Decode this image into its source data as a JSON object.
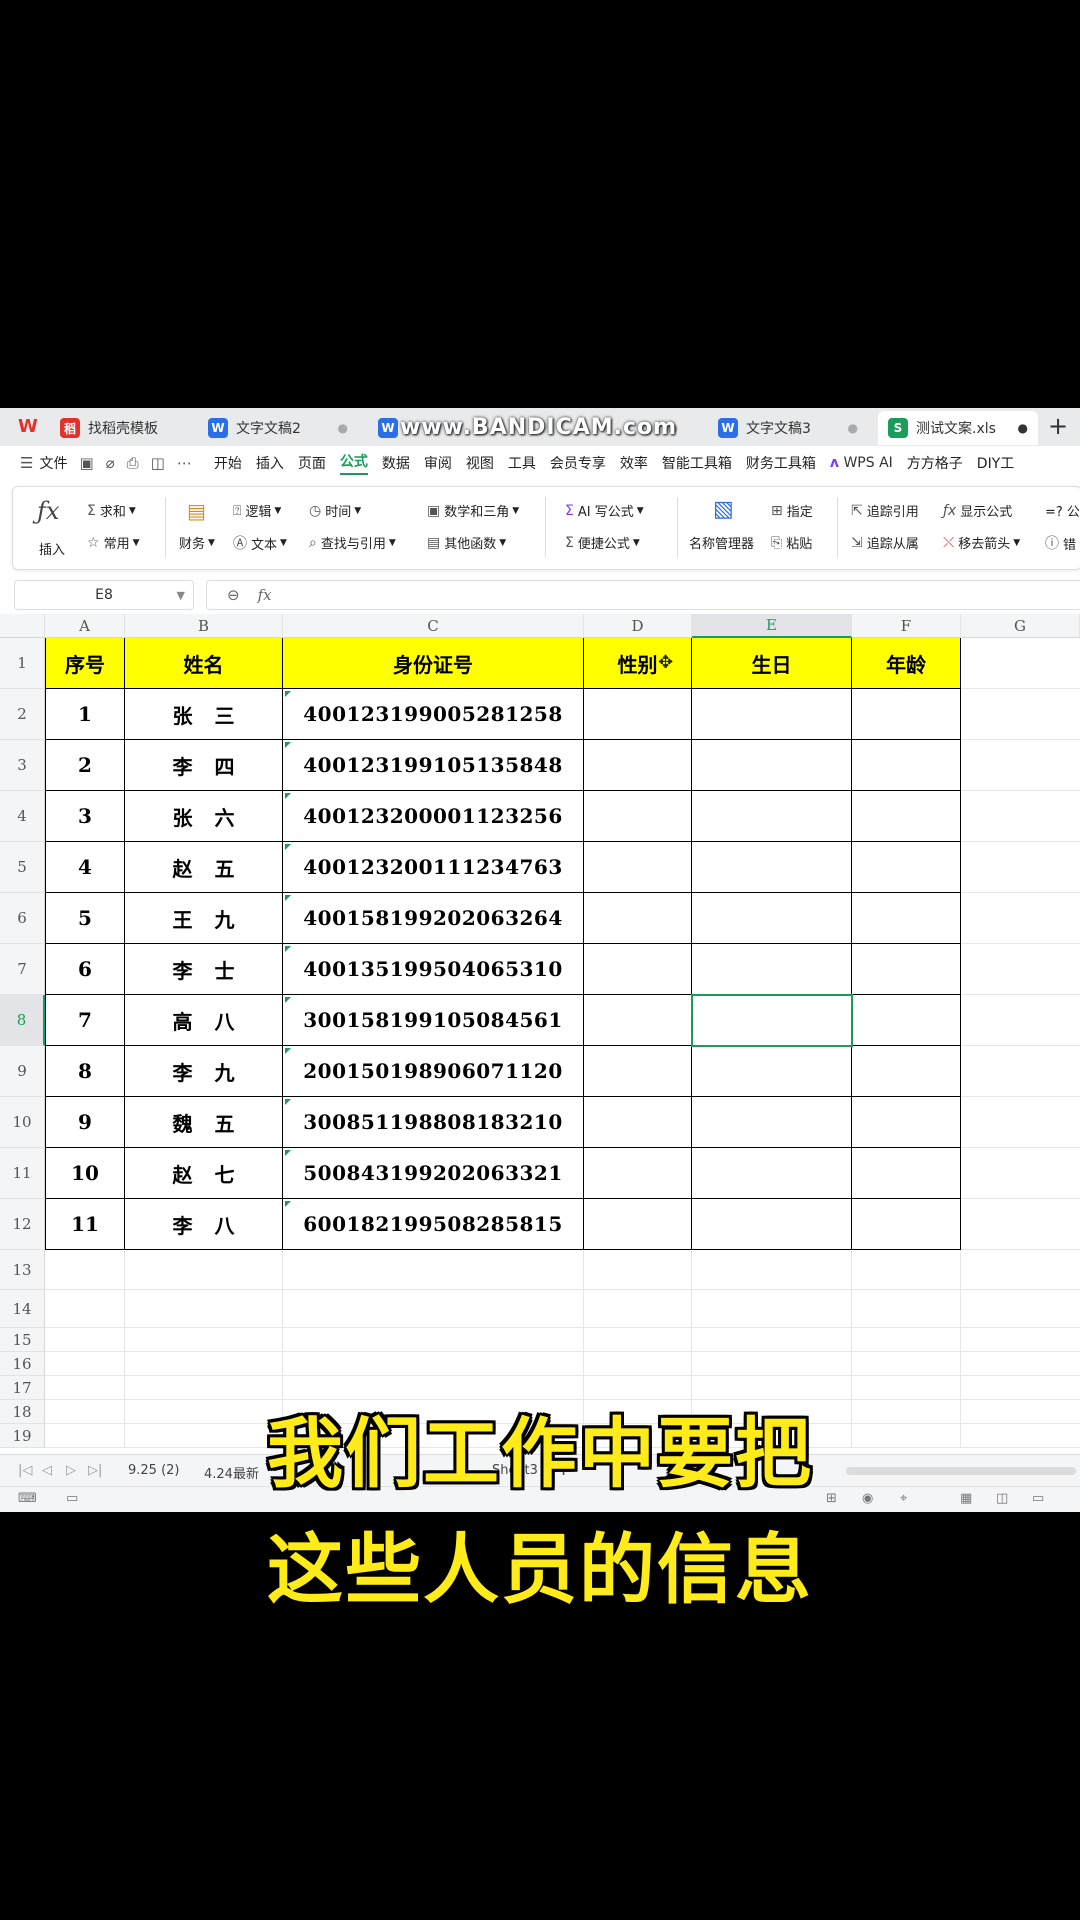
{
  "tabs": [
    {
      "label": "找稻壳模板",
      "icon": "稻"
    },
    {
      "label": "文字文稿2",
      "icon": "W"
    },
    {
      "label": "",
      "icon": "W"
    },
    {
      "label": "文字文稿3",
      "icon": "W"
    },
    {
      "label": "测试文案.xls",
      "icon": "S"
    }
  ],
  "watermark": "www.BANDICAM.com",
  "new_tab": "+",
  "menu": {
    "file": "文件",
    "items": [
      "开始",
      "插入",
      "页面",
      "公式",
      "数据",
      "审阅",
      "视图",
      "工具",
      "会员专享",
      "效率",
      "智能工具箱",
      "财务工具箱",
      "WPS AI",
      "方方格子",
      "DIY工"
    ]
  },
  "ribbon": {
    "insert_fn": "插入",
    "sum": "求和",
    "common": "常用",
    "finance": "财务",
    "logic": "逻辑",
    "text": "文本",
    "time": "时间",
    "lookup": "查找与引用",
    "math": "数学和三角",
    "other": "其他函数",
    "ai_formula": "AI 写公式",
    "quick_formula": "便捷公式",
    "name_mgr": "名称管理器",
    "specify": "指定",
    "paste": "粘贴",
    "trace_prec": "追踪引用",
    "trace_dep": "追踪从属",
    "show_formula": "显示公式",
    "remove_arrows": "移去箭头",
    "eq": "=? 公",
    "err": "错"
  },
  "formula_bar": {
    "name_box": "E8",
    "fx": "fx",
    "value": ""
  },
  "columns": [
    "A",
    "B",
    "C",
    "D",
    "E",
    "F",
    "G"
  ],
  "rows": [
    "1",
    "2",
    "3",
    "4",
    "5",
    "6",
    "7",
    "8",
    "9",
    "10",
    "11",
    "12",
    "13",
    "14",
    "15",
    "16",
    "17",
    "18",
    "19"
  ],
  "table": {
    "headers": [
      "序号",
      "姓名",
      "身份证号",
      "性别",
      "生日",
      "年龄"
    ],
    "rows": [
      [
        "1",
        "张三",
        "400123199005281258"
      ],
      [
        "2",
        "李四",
        "400123199105135848"
      ],
      [
        "3",
        "张六",
        "400123200001123256"
      ],
      [
        "4",
        "赵五",
        "400123200111234763"
      ],
      [
        "5",
        "王九",
        "400158199202063264"
      ],
      [
        "6",
        "李士",
        "400135199504065310"
      ],
      [
        "7",
        "高八",
        "300158199105084561"
      ],
      [
        "8",
        "李九",
        "200150198906071120"
      ],
      [
        "9",
        "魏五",
        "300851198808183210"
      ],
      [
        "10",
        "赵七",
        "500843199202063321"
      ],
      [
        "11",
        "李八",
        "600182199508285815"
      ]
    ]
  },
  "sheet_tabs": [
    "9.25 (2)",
    "4.24最新",
    "",
    "",
    "Sheet3"
  ],
  "subtitles": [
    "我们工作中要把",
    "这些人员的信息"
  ]
}
